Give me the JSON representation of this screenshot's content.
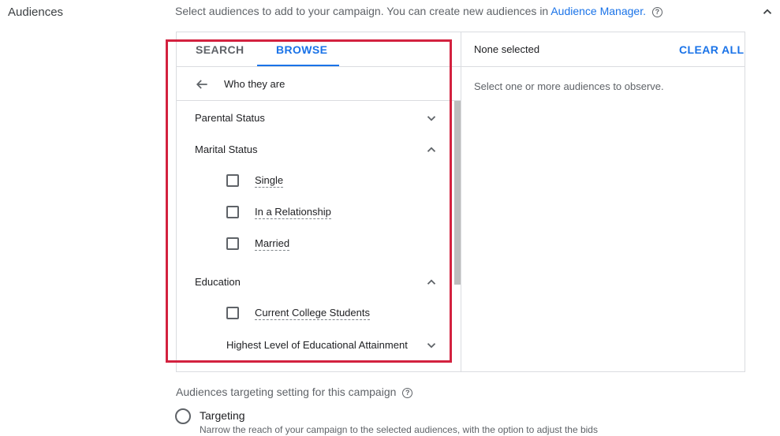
{
  "section": {
    "title": "Audiences",
    "intro_text": "Select audiences to add to your campaign. You can create new audiences in",
    "intro_link": "Audience Manager.",
    "help_glyph": "?"
  },
  "tabs": [
    {
      "label": "SEARCH",
      "active": false
    },
    {
      "label": "BROWSE",
      "active": true
    }
  ],
  "browse": {
    "back_label": "Who they are",
    "categories": {
      "parental": {
        "label": "Parental Status",
        "expanded": false
      },
      "marital": {
        "label": "Marital Status",
        "expanded": true,
        "options": [
          "Single",
          "In a Relationship",
          "Married"
        ]
      },
      "education": {
        "label": "Education",
        "expanded": true,
        "options": [
          "Current College Students"
        ],
        "subcategory": {
          "label": "Highest Level of Educational Attainment",
          "expanded": false
        }
      }
    }
  },
  "selection": {
    "status": "None selected",
    "clear_all_label": "CLEAR ALL",
    "empty_message": "Select one or more audiences to observe."
  },
  "targeting_setting": {
    "title": "Audiences targeting setting for this campaign",
    "option_label": "Targeting",
    "option_description": "Narrow the reach of your campaign to the selected audiences, with the option to adjust the bids"
  },
  "colors": {
    "accent": "#1a73e8",
    "highlight_border": "#d3223f"
  }
}
